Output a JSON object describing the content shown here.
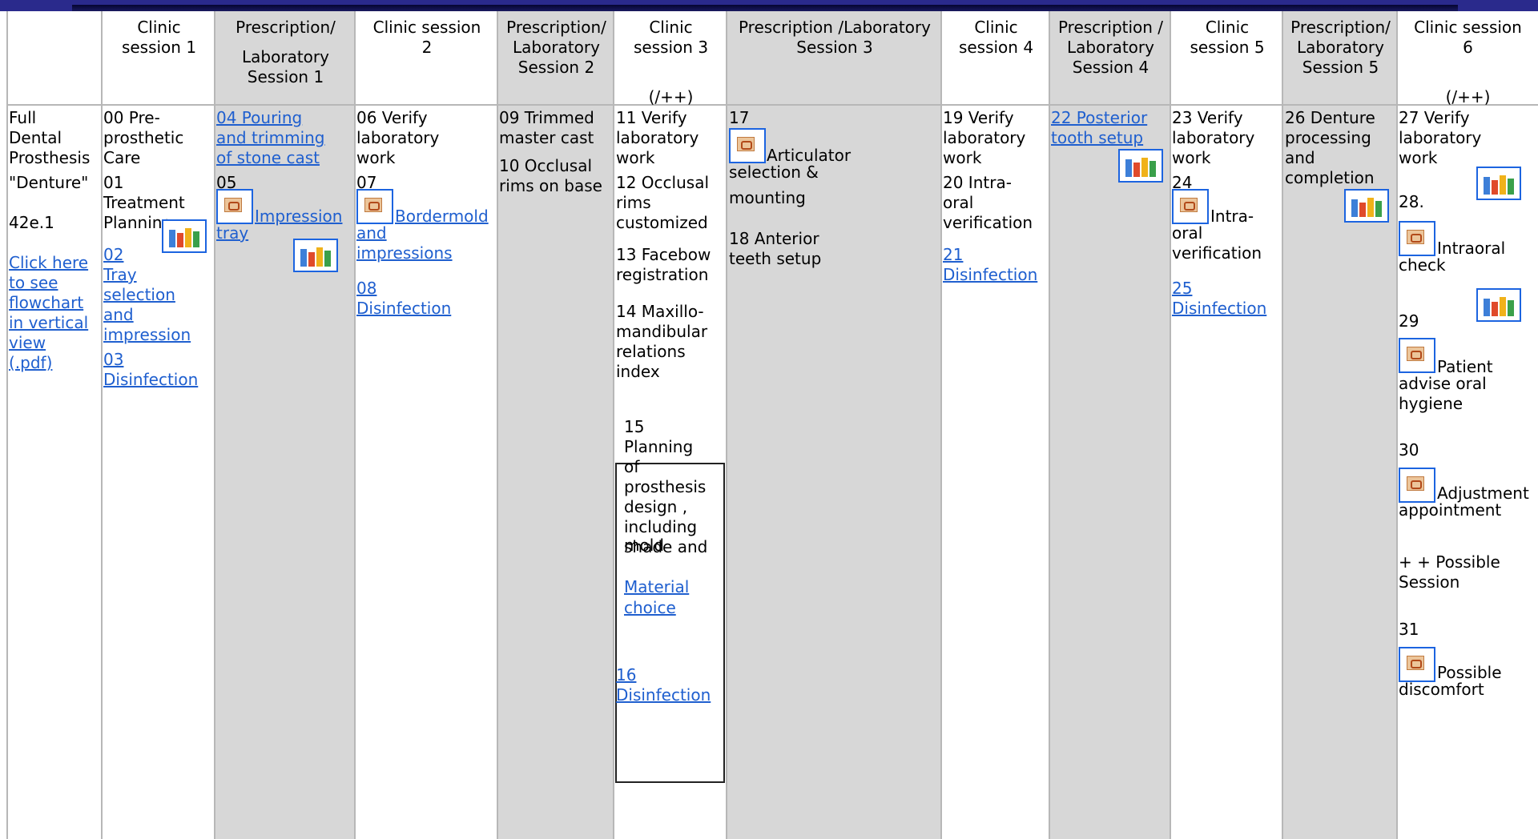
{
  "headers": {
    "c1": "Clinic\nsession 1",
    "c2a": "Prescription/",
    "c2b": "Laboratory\nSession 1",
    "c3": "Clinic session\n2",
    "c4": "Prescription/\nLaboratory\nSession 2",
    "c5a": "Clinic\nsession 3",
    "c5b": "(/++)",
    "c6": "Prescription /Laboratory\nSession 3",
    "c7": "Clinic\nsession 4",
    "c8": "Prescription /\nLaboratory\nSession 4",
    "c9": "Clinic\nsession 5",
    "c10": "Prescription/\nLaboratory\nSession 5",
    "c11a": "Clinic session\n6",
    "c11b": "(/++)"
  },
  "col0": {
    "title": "Full\nDental\nProsthesis",
    "alias": "\"Denture\"",
    "code": "42e.1",
    "link": "Click here\nto see\nflowchart\nin vertical\nview\n(.pdf)"
  },
  "col1": {
    "s00": "00 Pre-\nprosthetic\nCare",
    "s01": "01\nTreatment\nPlanning",
    "s02": "02\nTray\nselection\nand\nimpression",
    "s03": "03\nDisinfection"
  },
  "col2": {
    "s04": "04 Pouring\nand trimming\nof stone cast",
    "s05num": "05",
    "s05a": "Impression",
    "s05b": "tray"
  },
  "col3": {
    "s06": "06 Verify\nlaboratory\nwork",
    "s07num": "07",
    "s07a": "Bordermold",
    "s07b": "and\nimpressions",
    "s08": "08\nDisinfection"
  },
  "col4": {
    "s09": "09 Trimmed\nmaster cast",
    "s10": "10 Occlusal\nrims on base"
  },
  "col5": {
    "s11": "11 Verify\nlaboratory\nwork",
    "s12": "12 Occlusal\nrims\ncustomized",
    "s13": "13 Facebow\nregistration",
    "s14": "14 Maxillo-\nmandibular\nrelations\nindex",
    "s15": "15\nPlanning\nof\nprosthesis\ndesign ,\nincluding\nshade and",
    "s15b": "mold",
    "material": "Material\nchoice",
    "s16": "16\nDisinfection"
  },
  "col6": {
    "s17num": "17",
    "s17a": "Articulator",
    "s17b": "selection &",
    "s17c": "mounting",
    "s18": "18 Anterior\nteeth setup"
  },
  "col7": {
    "s19": "19 Verify\nlaboratory\nwork",
    "s20": "20 Intra-\noral\nverification",
    "s21": "21\nDisinfection"
  },
  "col8": {
    "s22": "22 Posterior\ntooth setup"
  },
  "col9": {
    "s23": "23 Verify\nlaboratory\nwork",
    "s24num": "24",
    "s24a": "Intra-",
    "s24b": "oral\nverification",
    "s25": "25\nDisinfection"
  },
  "col10": {
    "s26": "26 Denture\nprocessing\nand\ncompletion"
  },
  "col11": {
    "s27": "27 Verify\nlaboratory\nwork",
    "s28num": "28.",
    "s28a": "Intraoral",
    "s28b": "check",
    "s29num": "29",
    "s29a": "Patient",
    "s29b": "advise oral\nhygiene",
    "s30num": "30",
    "s30a": "Adjustment",
    "s30b": "appointment",
    "plus": "+  + Possible\nSession",
    "s31num": "31",
    "s31a": "Possible",
    "s31b": "discomfort"
  },
  "icons": {
    "ppt": "presentation-file-icon",
    "people": "people-group-icon"
  }
}
